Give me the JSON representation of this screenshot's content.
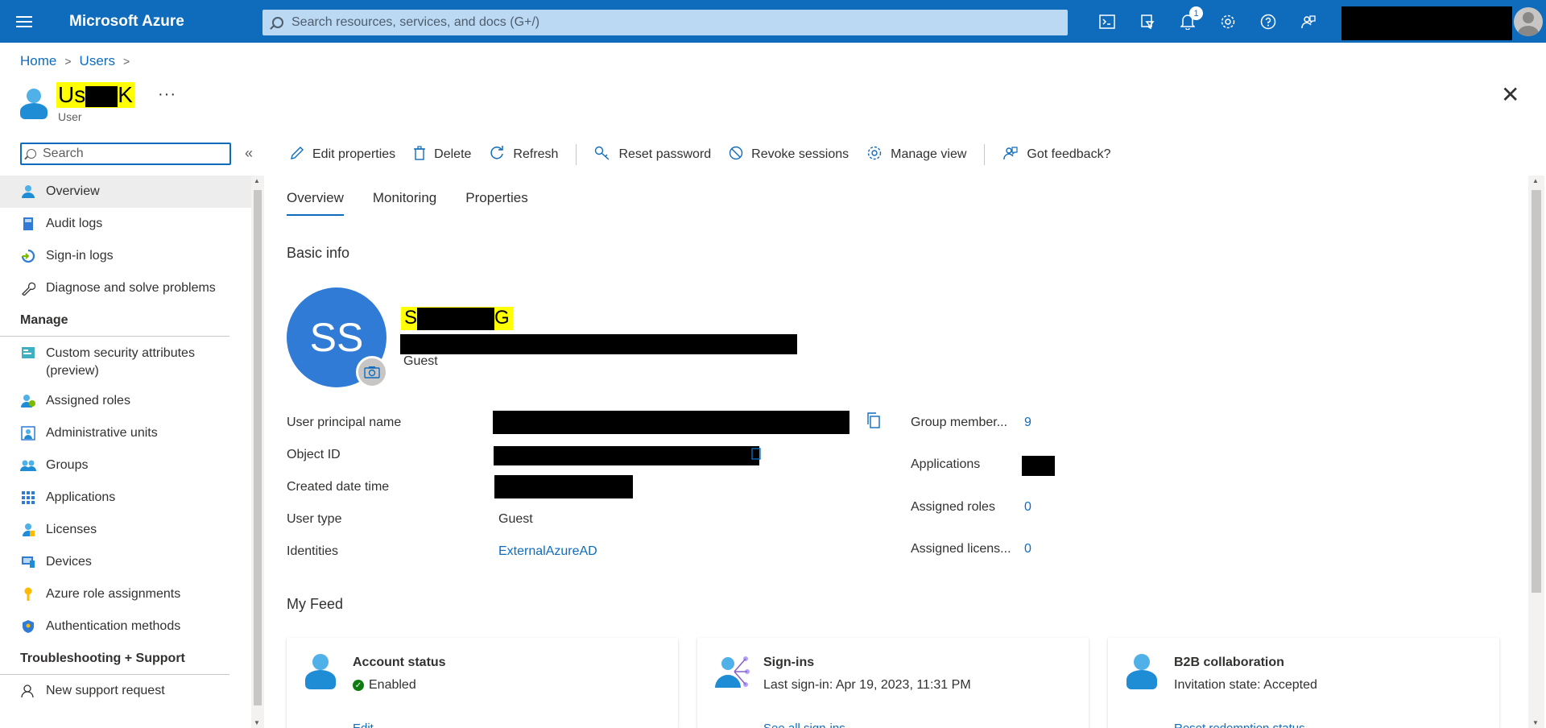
{
  "topbar": {
    "brand": "Microsoft Azure",
    "search_placeholder": "Search resources, services, and docs (G+/)",
    "notification_count": "1",
    "accent": "#0f6cbd"
  },
  "breadcrumb": {
    "home": "Home",
    "users": "Users"
  },
  "header": {
    "name_start": "Us",
    "name_end": "K",
    "subtitle": "User",
    "more": "···",
    "close": "✕"
  },
  "sidebar": {
    "search_placeholder": "Search",
    "collapse": "«",
    "items": [
      {
        "label": "Overview",
        "icon": "user-icon"
      },
      {
        "label": "Audit logs",
        "icon": "book-icon"
      },
      {
        "label": "Sign-in logs",
        "icon": "signin-icon"
      },
      {
        "label": "Diagnose and solve problems",
        "icon": "wrench-icon"
      }
    ],
    "manage_title": "Manage",
    "manage_items": [
      {
        "label": "Custom security attributes (preview)",
        "icon": "attributes-icon"
      },
      {
        "label": "Assigned roles",
        "icon": "roles-icon"
      },
      {
        "label": "Administrative units",
        "icon": "admin-units-icon"
      },
      {
        "label": "Groups",
        "icon": "groups-icon"
      },
      {
        "label": "Applications",
        "icon": "apps-icon"
      },
      {
        "label": "Licenses",
        "icon": "licenses-icon"
      },
      {
        "label": "Devices",
        "icon": "devices-icon"
      },
      {
        "label": "Azure role assignments",
        "icon": "key-icon"
      },
      {
        "label": "Authentication methods",
        "icon": "shield-icon"
      }
    ],
    "support_title": "Troubleshooting + Support",
    "support_items": [
      {
        "label": "New support request",
        "icon": "support-icon"
      }
    ]
  },
  "commands": {
    "edit": "Edit properties",
    "delete": "Delete",
    "refresh": "Refresh",
    "reset_password": "Reset password",
    "revoke": "Revoke sessions",
    "manage_view": "Manage view",
    "feedback": "Got feedback?"
  },
  "tabs": [
    "Overview",
    "Monitoring",
    "Properties"
  ],
  "basic_info": {
    "title": "Basic info",
    "initials": "SS",
    "name_start": "S",
    "name_end": "G",
    "user_type_badge": "Guest",
    "fields": {
      "upn_label": "User principal name",
      "object_id_label": "Object ID",
      "created_label": "Created date time",
      "user_type_label": "User type",
      "user_type_value": "Guest",
      "identities_label": "Identities",
      "identities_value": "ExternalAzureAD"
    },
    "stats": {
      "groups_label": "Group member...",
      "groups_value": "9",
      "apps_label": "Applications",
      "roles_label": "Assigned roles",
      "roles_value": "0",
      "licenses_label": "Assigned licens...",
      "licenses_value": "0"
    }
  },
  "feed": {
    "title": "My Feed",
    "cards": [
      {
        "title": "Account status",
        "status": "Enabled",
        "link": "Edit"
      },
      {
        "title": "Sign-ins",
        "status": "Last sign-in: Apr 19, 2023, 11:31 PM",
        "link": "See all sign-ins"
      },
      {
        "title": "B2B collaboration",
        "status": "Invitation state: Accepted",
        "link": "Reset redemption status"
      }
    ]
  }
}
